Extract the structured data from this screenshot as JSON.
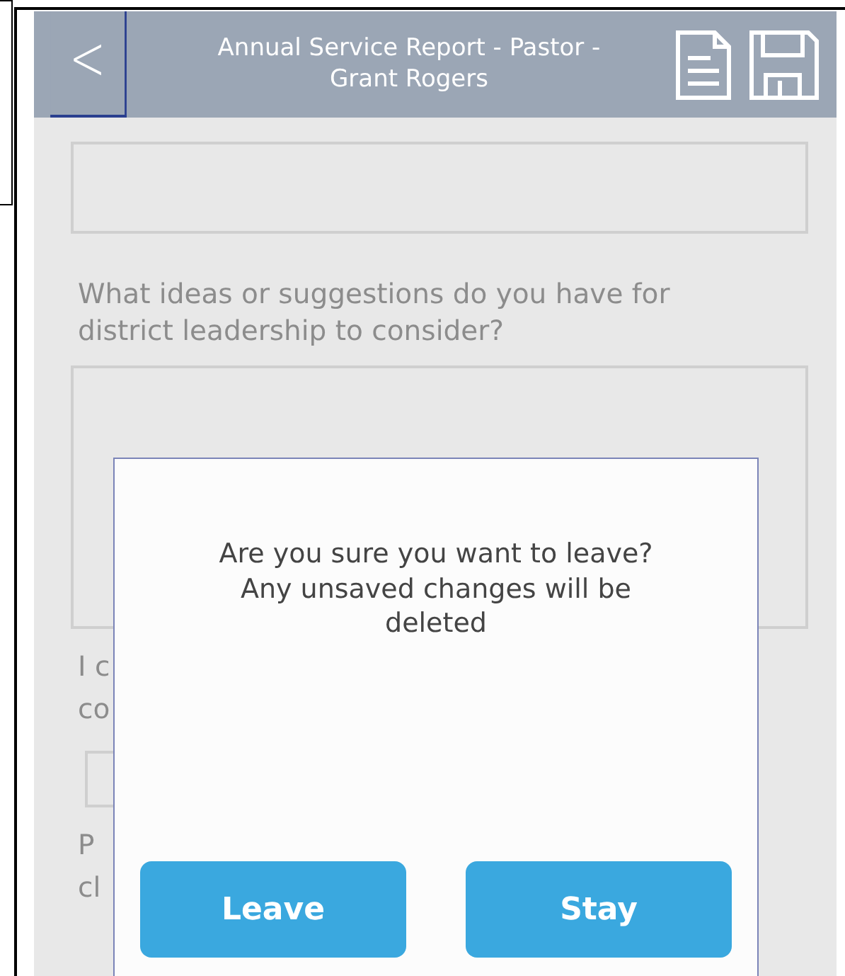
{
  "header": {
    "back_glyph": "<",
    "title": "Annual Service Report - Pastor - Grant Rogers"
  },
  "form": {
    "questions": [
      {
        "kind": "field"
      },
      {
        "kind": "area",
        "label": "What ideas or suggestions do you have for district leadership to consider?"
      },
      {
        "kind": "clipped",
        "lines": [
          "I c",
          "co"
        ]
      },
      {
        "kind": "small-field"
      },
      {
        "kind": "clipped",
        "lines": [
          "P",
          "cl"
        ]
      }
    ]
  },
  "dialog": {
    "message": "Are you sure you want to leave? Any unsaved changes will be deleted",
    "buttons": [
      "Leave",
      "Stay"
    ]
  }
}
